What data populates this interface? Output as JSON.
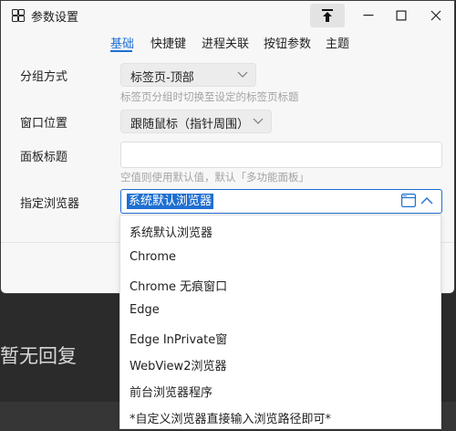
{
  "window": {
    "title": "参数设置",
    "icons": {
      "app": "grid-app-icon",
      "pin": "pin-top-icon",
      "minimize": "minimize-icon",
      "maximize": "maximize-icon",
      "close": "close-icon"
    }
  },
  "tabs": [
    {
      "label": "基础",
      "active": true
    },
    {
      "label": "快捷键",
      "active": false
    },
    {
      "label": "进程关联",
      "active": false
    },
    {
      "label": "按钮参数",
      "active": false
    },
    {
      "label": "主题",
      "active": false
    }
  ],
  "settings": {
    "group_mode": {
      "label": "分组方式",
      "value": "标签页-顶部",
      "hint": "标签页分组时切换至设定的标签页标题"
    },
    "window_position": {
      "label": "窗口位置",
      "value": "跟随鼠标（指针周围）"
    },
    "panel_title": {
      "label": "面板标题",
      "value": "",
      "hint": "空值则使用默认值，默认「多功能面板」"
    },
    "browser": {
      "label": "指定浏览器",
      "value": "系统默认浏览器"
    }
  },
  "browser_options": [
    "系统默认浏览器",
    "Chrome",
    "Chrome 无痕窗口",
    "Edge",
    "Edge InPrivate窗",
    "WebView2浏览器",
    "前台浏览器程序",
    "*自定义浏览器直接输入浏览路径即可*"
  ],
  "background": {
    "text": "暂无回复"
  },
  "colors": {
    "accent": "#1f6fd1",
    "hint": "#a3a3a3",
    "window_bg": "#f7f7f7",
    "backdrop": "#2b2b2b"
  }
}
